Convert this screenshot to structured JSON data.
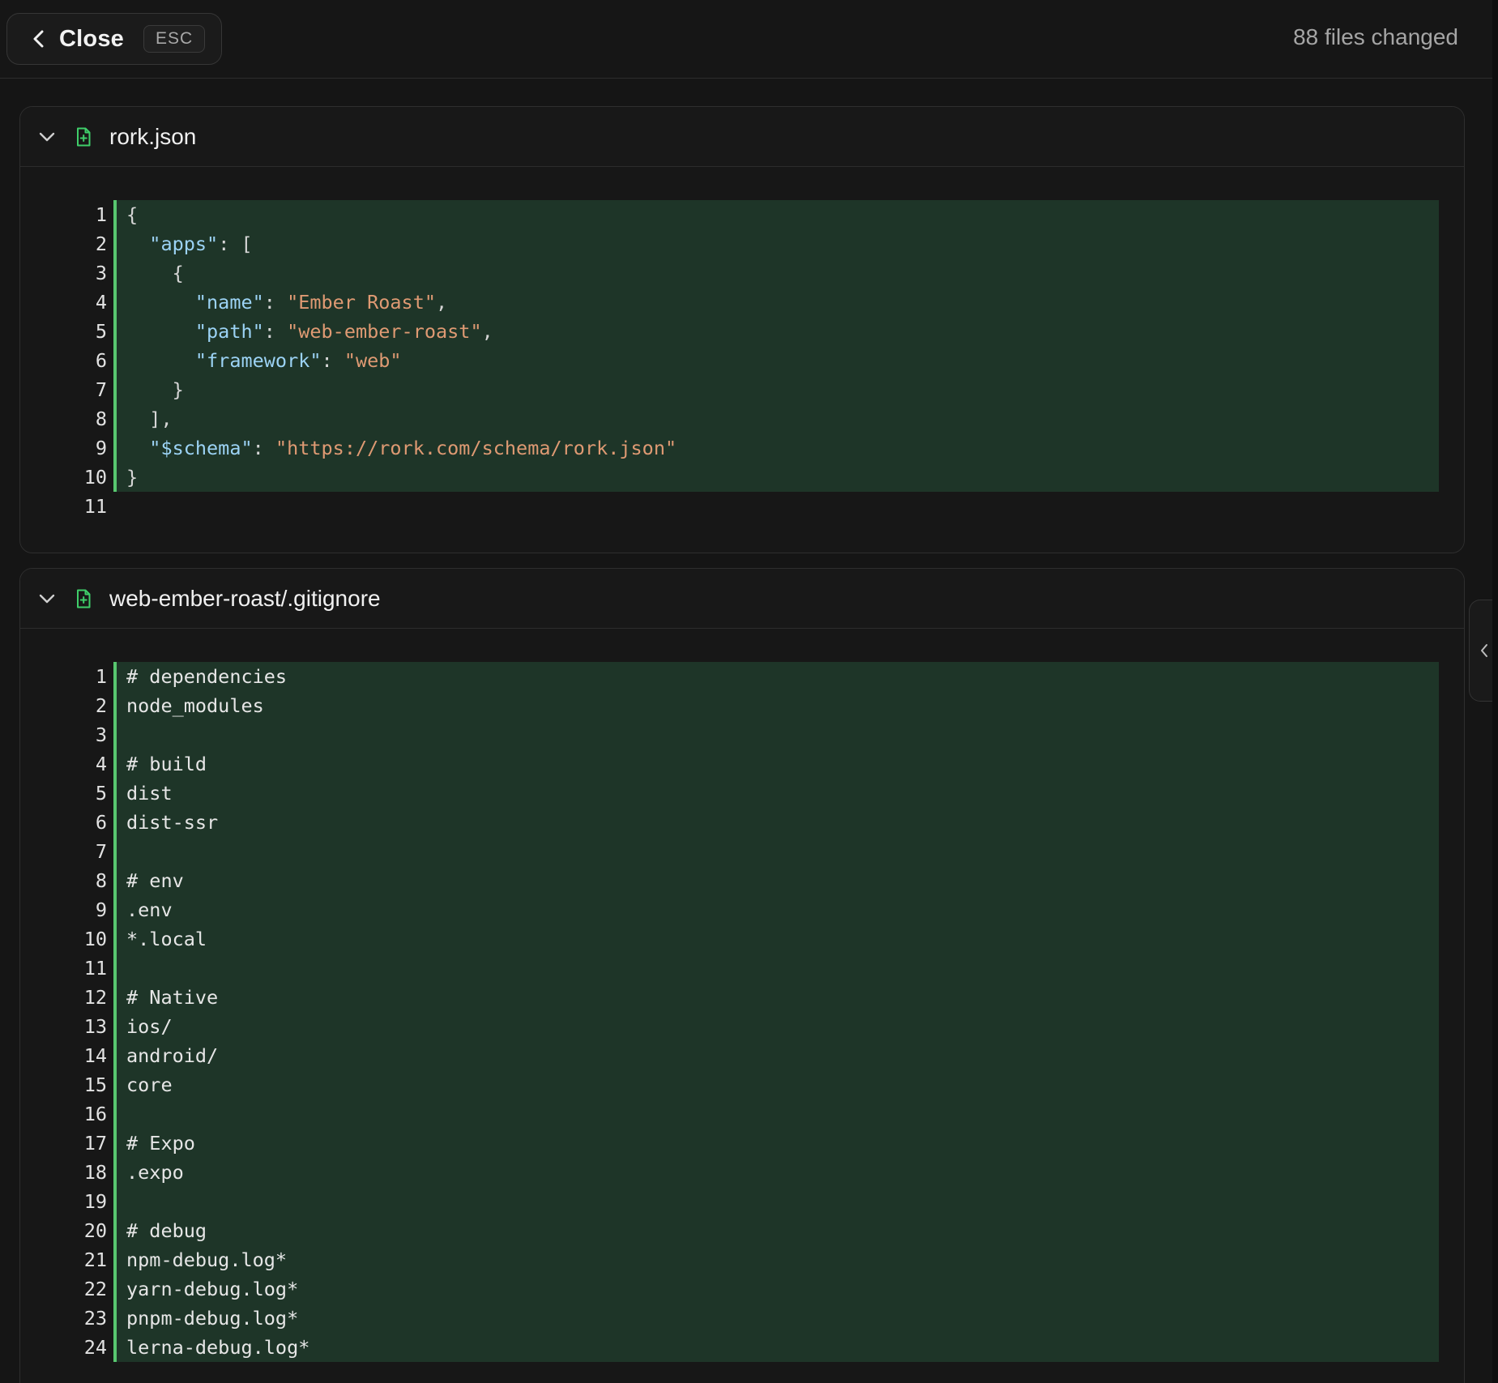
{
  "header": {
    "close_label": "Close",
    "esc_label": "ESC",
    "files_changed": "88 files changed"
  },
  "icons": {
    "close": "chevron-left-icon",
    "toggle": "chevron-down-icon",
    "file": "file-added-icon",
    "side": "chevron-left-icon"
  },
  "colors": {
    "added_bg": "#1e3528",
    "added_bar": "#58c76f",
    "key": "#9cd3f5",
    "string": "#df9a73",
    "file_icon": "#3fce6a"
  },
  "files": [
    {
      "name": "rork.json",
      "lines": [
        {
          "n": "1",
          "added": true,
          "tokens": [
            {
              "t": "{",
              "c": "pun"
            }
          ]
        },
        {
          "n": "2",
          "added": true,
          "tokens": [
            {
              "t": "  ",
              "c": "pun"
            },
            {
              "t": "\"apps\"",
              "c": "key"
            },
            {
              "t": ": [",
              "c": "pun"
            }
          ]
        },
        {
          "n": "3",
          "added": true,
          "tokens": [
            {
              "t": "    {",
              "c": "pun"
            }
          ]
        },
        {
          "n": "4",
          "added": true,
          "tokens": [
            {
              "t": "      ",
              "c": "pun"
            },
            {
              "t": "\"name\"",
              "c": "key"
            },
            {
              "t": ": ",
              "c": "pun"
            },
            {
              "t": "\"Ember Roast\"",
              "c": "str"
            },
            {
              "t": ",",
              "c": "pun"
            }
          ]
        },
        {
          "n": "5",
          "added": true,
          "tokens": [
            {
              "t": "      ",
              "c": "pun"
            },
            {
              "t": "\"path\"",
              "c": "key"
            },
            {
              "t": ": ",
              "c": "pun"
            },
            {
              "t": "\"web-ember-roast\"",
              "c": "str"
            },
            {
              "t": ",",
              "c": "pun"
            }
          ]
        },
        {
          "n": "6",
          "added": true,
          "tokens": [
            {
              "t": "      ",
              "c": "pun"
            },
            {
              "t": "\"framework\"",
              "c": "key"
            },
            {
              "t": ": ",
              "c": "pun"
            },
            {
              "t": "\"web\"",
              "c": "str"
            }
          ]
        },
        {
          "n": "7",
          "added": true,
          "tokens": [
            {
              "t": "    }",
              "c": "pun"
            }
          ]
        },
        {
          "n": "8",
          "added": true,
          "tokens": [
            {
              "t": "  ],",
              "c": "pun"
            }
          ]
        },
        {
          "n": "9",
          "added": true,
          "tokens": [
            {
              "t": "  ",
              "c": "pun"
            },
            {
              "t": "\"$schema\"",
              "c": "key"
            },
            {
              "t": ": ",
              "c": "pun"
            },
            {
              "t": "\"https://rork.com/schema/rork.json\"",
              "c": "str"
            }
          ]
        },
        {
          "n": "10",
          "added": true,
          "tokens": [
            {
              "t": "}",
              "c": "pun"
            }
          ]
        },
        {
          "n": "11",
          "added": false,
          "tokens": []
        }
      ]
    },
    {
      "name": "web-ember-roast/.gitignore",
      "lines": [
        {
          "n": "1",
          "added": true,
          "tokens": [
            {
              "t": "# dependencies",
              "c": "txt"
            }
          ]
        },
        {
          "n": "2",
          "added": true,
          "tokens": [
            {
              "t": "node_modules",
              "c": "txt"
            }
          ]
        },
        {
          "n": "3",
          "added": true,
          "tokens": []
        },
        {
          "n": "4",
          "added": true,
          "tokens": [
            {
              "t": "# build",
              "c": "txt"
            }
          ]
        },
        {
          "n": "5",
          "added": true,
          "tokens": [
            {
              "t": "dist",
              "c": "txt"
            }
          ]
        },
        {
          "n": "6",
          "added": true,
          "tokens": [
            {
              "t": "dist-ssr",
              "c": "txt"
            }
          ]
        },
        {
          "n": "7",
          "added": true,
          "tokens": []
        },
        {
          "n": "8",
          "added": true,
          "tokens": [
            {
              "t": "# env",
              "c": "txt"
            }
          ]
        },
        {
          "n": "9",
          "added": true,
          "tokens": [
            {
              "t": ".env",
              "c": "txt"
            }
          ]
        },
        {
          "n": "10",
          "added": true,
          "tokens": [
            {
              "t": "*.local",
              "c": "txt"
            }
          ]
        },
        {
          "n": "11",
          "added": true,
          "tokens": []
        },
        {
          "n": "12",
          "added": true,
          "tokens": [
            {
              "t": "# Native",
              "c": "txt"
            }
          ]
        },
        {
          "n": "13",
          "added": true,
          "tokens": [
            {
              "t": "ios/",
              "c": "txt"
            }
          ]
        },
        {
          "n": "14",
          "added": true,
          "tokens": [
            {
              "t": "android/",
              "c": "txt"
            }
          ]
        },
        {
          "n": "15",
          "added": true,
          "tokens": [
            {
              "t": "core",
              "c": "txt"
            }
          ]
        },
        {
          "n": "16",
          "added": true,
          "tokens": []
        },
        {
          "n": "17",
          "added": true,
          "tokens": [
            {
              "t": "# Expo",
              "c": "txt"
            }
          ]
        },
        {
          "n": "18",
          "added": true,
          "tokens": [
            {
              "t": ".expo",
              "c": "txt"
            }
          ]
        },
        {
          "n": "19",
          "added": true,
          "tokens": []
        },
        {
          "n": "20",
          "added": true,
          "tokens": [
            {
              "t": "# debug",
              "c": "txt"
            }
          ]
        },
        {
          "n": "21",
          "added": true,
          "tokens": [
            {
              "t": "npm-debug.log*",
              "c": "txt"
            }
          ]
        },
        {
          "n": "22",
          "added": true,
          "tokens": [
            {
              "t": "yarn-debug.log*",
              "c": "txt"
            }
          ]
        },
        {
          "n": "23",
          "added": true,
          "tokens": [
            {
              "t": "pnpm-debug.log*",
              "c": "txt"
            }
          ]
        },
        {
          "n": "24",
          "added": true,
          "tokens": [
            {
              "t": "lerna-debug.log*",
              "c": "txt"
            }
          ]
        }
      ]
    }
  ]
}
